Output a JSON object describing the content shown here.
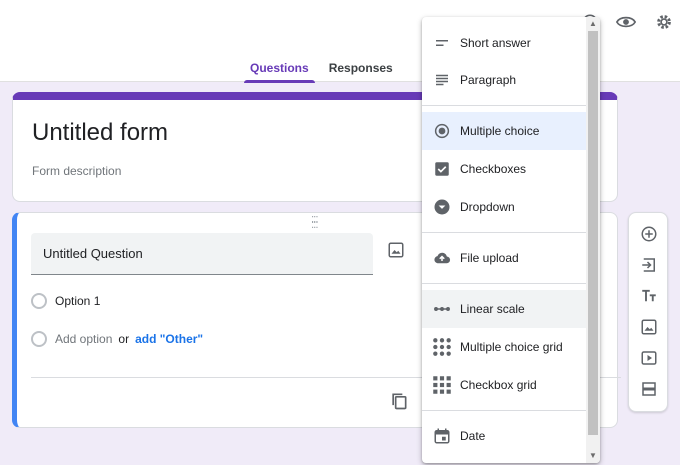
{
  "tabs": [
    {
      "label": "Questions"
    },
    {
      "label": "Responses"
    }
  ],
  "form": {
    "title": "Untitled form",
    "description_placeholder": "Form description"
  },
  "question": {
    "title": "Untitled Question",
    "option1": "Option 1",
    "add_option": "Add option",
    "or_text": "or",
    "add_other": "add \"Other\""
  },
  "menu": {
    "items": [
      {
        "label": "Short answer",
        "icon": "short-answer-icon"
      },
      {
        "label": "Paragraph",
        "icon": "paragraph-icon"
      },
      {
        "label": "Multiple choice",
        "icon": "radio-button-icon"
      },
      {
        "label": "Checkboxes",
        "icon": "checkbox-icon"
      },
      {
        "label": "Dropdown",
        "icon": "dropdown-icon"
      },
      {
        "label": "File upload",
        "icon": "cloud-upload-icon"
      },
      {
        "label": "Linear scale",
        "icon": "linear-scale-icon"
      },
      {
        "label": "Multiple choice grid",
        "icon": "dot-grid-icon"
      },
      {
        "label": "Checkbox grid",
        "icon": "square-grid-icon"
      },
      {
        "label": "Date",
        "icon": "calendar-icon"
      }
    ]
  },
  "colors": {
    "accent": "#673ab7",
    "question_border": "#4285f4",
    "background": "#f0ebf8",
    "link": "#1a73e8"
  }
}
